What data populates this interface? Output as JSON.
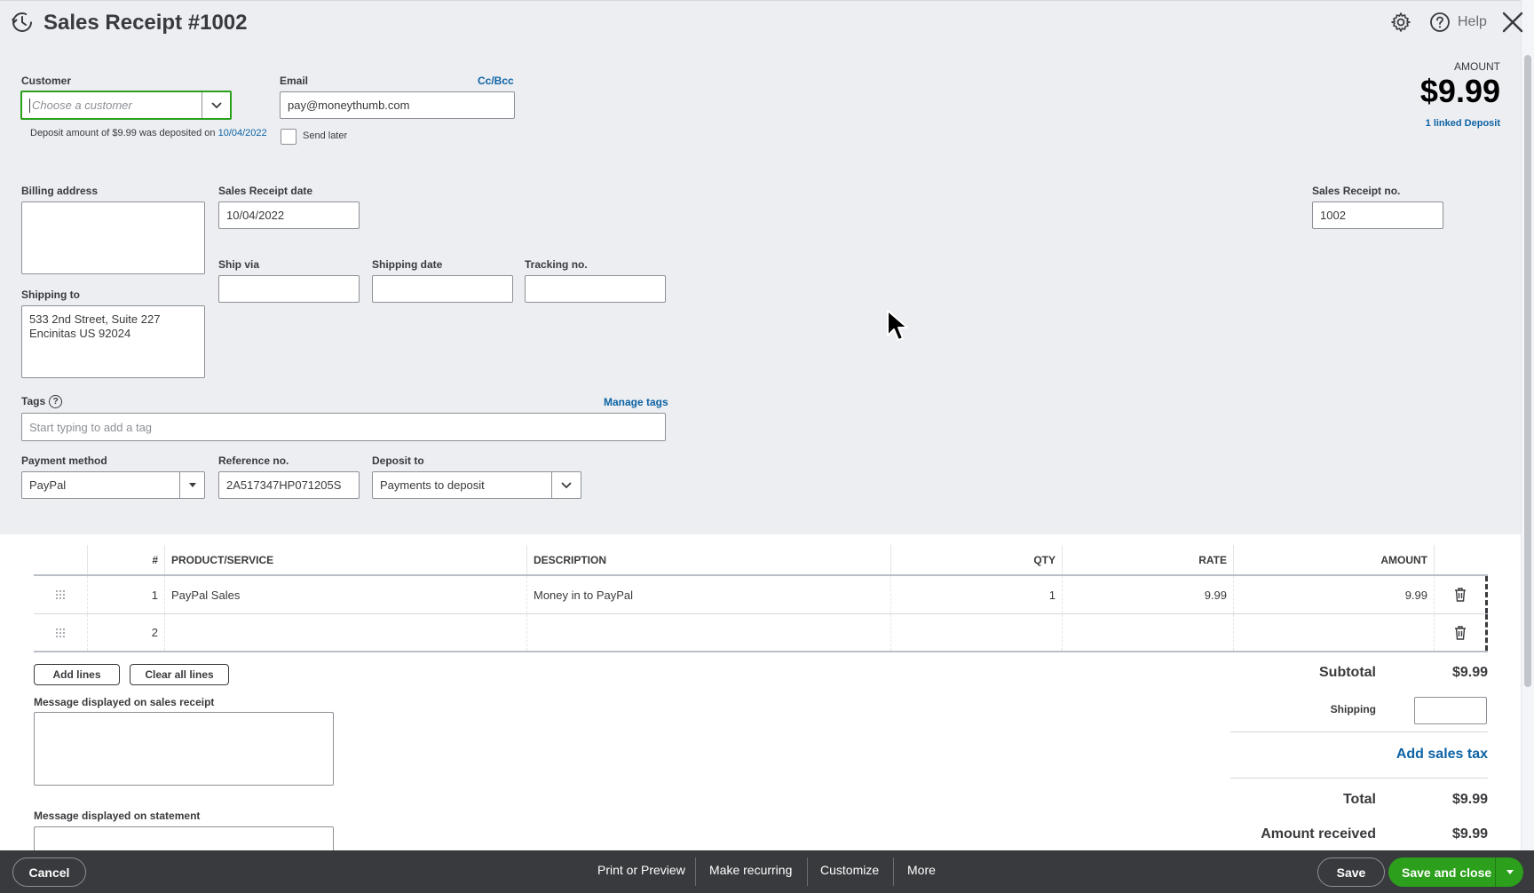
{
  "header": {
    "title": "Sales Receipt #1002",
    "help_label": "Help"
  },
  "customer": {
    "label": "Customer",
    "placeholder": "Choose a customer",
    "deposit_note_prefix": "Deposit amount of $9.99 was deposited on",
    "deposit_date_link": "10/04/2022"
  },
  "email": {
    "label": "Email",
    "cc_bcc": "Cc/Bcc",
    "value": "pay@moneythumb.com",
    "send_later": "Send later"
  },
  "amount": {
    "label": "AMOUNT",
    "value": "$9.99",
    "linked_deposit": "1 linked Deposit"
  },
  "billing": {
    "label": "Billing address",
    "value": ""
  },
  "receipt_date": {
    "label": "Sales Receipt date",
    "value": "10/04/2022"
  },
  "receipt_no": {
    "label": "Sales Receipt no.",
    "value": "1002"
  },
  "shipping": {
    "ship_via_label": "Ship via",
    "shipping_date_label": "Shipping date",
    "tracking_label": "Tracking no.",
    "shipping_to_label": "Shipping to",
    "address_line1": "533 2nd Street, Suite 227",
    "address_line2": "Encinitas US 92024"
  },
  "tags": {
    "label": "Tags",
    "manage": "Manage tags",
    "placeholder": "Start typing to add a tag"
  },
  "payment": {
    "method_label": "Payment method",
    "method_value": "PayPal",
    "ref_label": "Reference no.",
    "ref_value": "2A517347HP071205S",
    "deposit_label": "Deposit to",
    "deposit_value": "Payments to deposit"
  },
  "table": {
    "headers": {
      "num": "#",
      "product": "PRODUCT/SERVICE",
      "description": "DESCRIPTION",
      "qty": "QTY",
      "rate": "RATE",
      "amount": "AMOUNT"
    },
    "rows": [
      {
        "num": "1",
        "product": "PayPal Sales",
        "description": "Money in to PayPal",
        "qty": "1",
        "rate": "9.99",
        "amount": "9.99"
      },
      {
        "num": "2",
        "product": "",
        "description": "",
        "qty": "",
        "rate": "",
        "amount": ""
      }
    ],
    "add_lines": "Add lines",
    "clear_lines": "Clear all lines"
  },
  "messages": {
    "receipt_label": "Message displayed on sales receipt",
    "statement_label": "Message displayed on statement"
  },
  "totals": {
    "subtotal_label": "Subtotal",
    "subtotal_value": "$9.99",
    "shipping_label": "Shipping",
    "add_sales_tax": "Add sales tax",
    "total_label": "Total",
    "total_value": "$9.99",
    "received_label": "Amount received",
    "received_value": "$9.99"
  },
  "footer": {
    "cancel": "Cancel",
    "print_preview": "Print or Preview",
    "make_recurring": "Make recurring",
    "customize": "Customize",
    "more": "More",
    "save": "Save",
    "save_and_close": "Save and close"
  },
  "colors": {
    "accent_green": "#2ca01c",
    "link_blue": "#0d63a5",
    "footer_bg": "#393a3d",
    "top_bg": "#eceef1"
  }
}
